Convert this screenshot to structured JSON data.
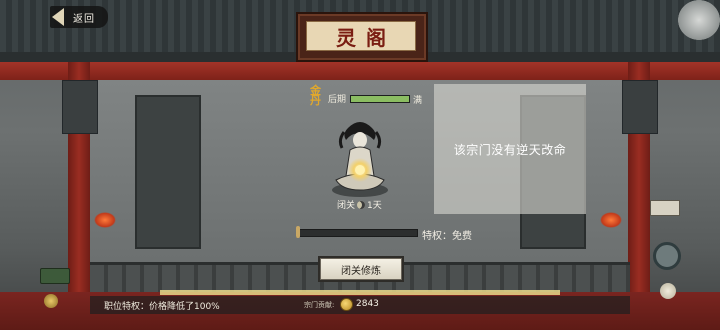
{
  "nav": {
    "back_label": "返回"
  },
  "title": "灵阁",
  "realm": {
    "badge": "金丹",
    "stage": "后期",
    "status": "满",
    "progress": 1.0
  },
  "seclusion": {
    "label": "闭关",
    "duration": "1天"
  },
  "cultivation_progress": 0.02,
  "privilege": "特权：免费",
  "close_button": "闭关修炼",
  "info_message": "该宗门没有逆天改命",
  "position_privilege": "职位特权：价格降低了100%",
  "contribution": {
    "label": "宗门贡献:",
    "value": "2843"
  },
  "colors": {
    "accent_red": "#9a2d22",
    "gold": "#e1a82c",
    "realm_bar": "#8bbd62"
  },
  "icons": [
    "back-arrow-icon",
    "moon-icon",
    "coin-icon",
    "meditating-figure-icon"
  ]
}
